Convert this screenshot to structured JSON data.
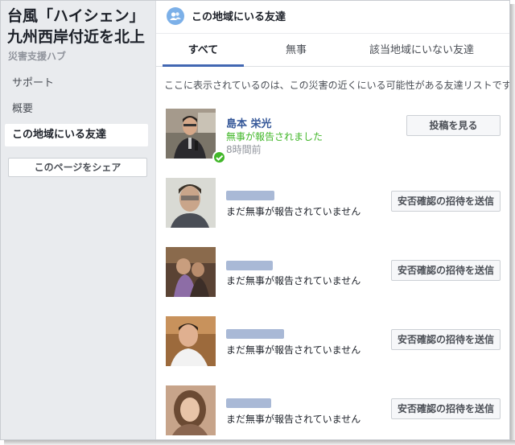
{
  "sidebar": {
    "hub_title": "台風「ハイシェン」九州西岸付近を北上",
    "hub_subtitle": "災害支援ハブ",
    "nav": [
      {
        "label": "サポート"
      },
      {
        "label": "概要"
      },
      {
        "label": "この地域にいる友達"
      }
    ],
    "share_label": "このページをシェア"
  },
  "header": {
    "icon": "friends-icon",
    "title": "この地域にいる友達"
  },
  "tabs": [
    {
      "label": "すべて",
      "active": true
    },
    {
      "label": "無事",
      "active": false
    },
    {
      "label": "該当地域にいない友達",
      "active": false
    }
  ],
  "intro_text": "ここに表示されているのは、この災害の近くにいる可能性がある友達リストです。",
  "friends": [
    {
      "name": "島本 栄光",
      "status": "無事が報告されました",
      "time": "8時間前",
      "button": "投稿を見る",
      "safe": true
    },
    {
      "name": "",
      "status": "まだ無事が報告されていません",
      "button": "安否確認の招待を送信",
      "safe": false
    },
    {
      "name": "",
      "status": "まだ無事が報告されていません",
      "button": "安否確認の招待を送信",
      "safe": false
    },
    {
      "name": "",
      "status": "まだ無事が報告されていません",
      "button": "安否確認の招待を送信",
      "safe": false
    },
    {
      "name": "",
      "status": "まだ無事が報告されていません",
      "button": "安否確認の招待を送信",
      "safe": false
    }
  ],
  "colors": {
    "accent": "#4267b2",
    "safe": "#42b72a",
    "link": "#365899",
    "sidebar_bg": "#e9ebee"
  }
}
